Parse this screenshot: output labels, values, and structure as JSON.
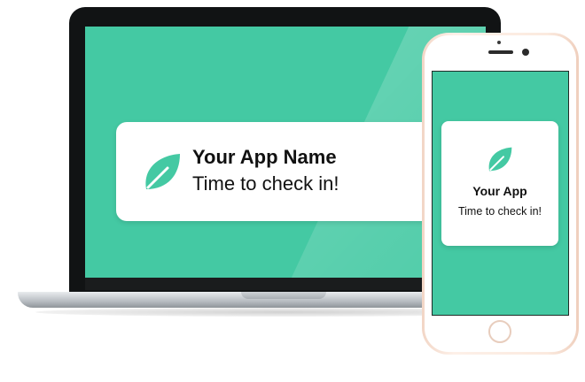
{
  "colors": {
    "screen_accent": "#44c9a3",
    "card_background": "#ffffff",
    "text": "#111111"
  },
  "laptop": {
    "notification": {
      "icon": "leaf-icon",
      "title": "Your App Name",
      "message": "Time to check in!"
    }
  },
  "phone": {
    "notification": {
      "icon": "leaf-icon",
      "title": "Your App",
      "message": "Time to check in!"
    }
  }
}
